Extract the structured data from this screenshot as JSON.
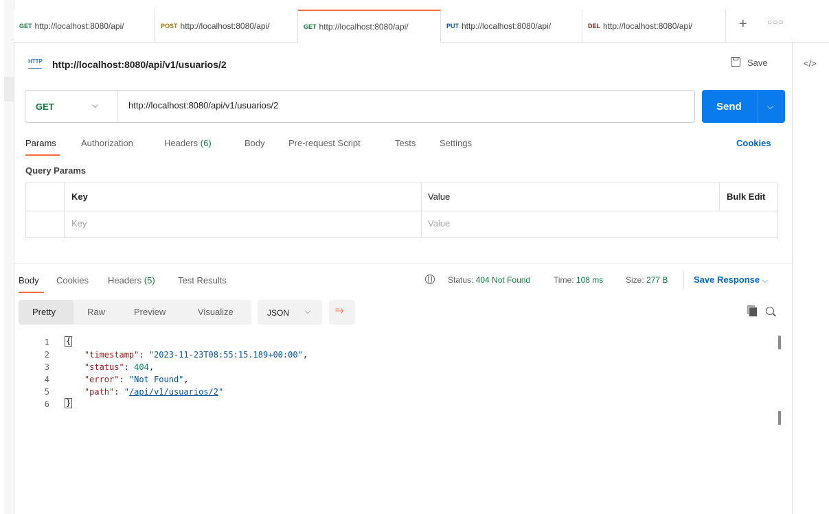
{
  "tabs": [
    {
      "method": "GET",
      "url": "http://localhost:8080/api/"
    },
    {
      "method": "POST",
      "url": "http://localhost:8080/api/"
    },
    {
      "method": "GET",
      "url": "http://localhost:8080/api/"
    },
    {
      "method": "PUT",
      "url": "http://localhost:8080/api/"
    },
    {
      "method": "DEL",
      "url": "http://localhost:8080/api/"
    }
  ],
  "request": {
    "title": "http://localhost:8080/api/v1/usuarios/2",
    "badge": "HTTP",
    "save_label": "Save",
    "method": "GET",
    "url": "http://localhost:8080/api/v1/usuarios/2",
    "send_label": "Send"
  },
  "request_tabs": {
    "params": "Params",
    "authorization": "Authorization",
    "headers": "Headers",
    "headers_count": "(6)",
    "body": "Body",
    "prerequest": "Pre-request Script",
    "tests": "Tests",
    "settings": "Settings",
    "cookies": "Cookies"
  },
  "query_params": {
    "title": "Query Params",
    "col_key": "Key",
    "col_value": "Value",
    "bulk_edit": "Bulk Edit",
    "key_placeholder": "Key",
    "value_placeholder": "Value"
  },
  "response": {
    "tabs": {
      "body": "Body",
      "cookies": "Cookies",
      "headers": "Headers",
      "headers_count": "(5)",
      "test_results": "Test Results"
    },
    "status_label": "Status:",
    "status_value": "404 Not Found",
    "time_label": "Time:",
    "time_value": "108 ms",
    "size_label": "Size:",
    "size_value": "277 B",
    "save_response": "Save Response",
    "formats": [
      "Pretty",
      "Raw",
      "Preview",
      "Visualize"
    ],
    "language": "JSON",
    "code": {
      "line_numbers": [
        "1",
        "2",
        "3",
        "4",
        "5",
        "6"
      ],
      "timestamp_key": "\"timestamp\"",
      "timestamp_value": "\"2023-11-23T08:55:15.189+00:00\"",
      "status_key": "\"status\"",
      "status_value": "404",
      "error_key": "\"error\"",
      "error_value": "\"Not Found\"",
      "path_key": "\"path\"",
      "path_value": "/api/v1/usuarios/2"
    }
  },
  "colors": {
    "accent": "#ff6c37",
    "send": "#097bed",
    "get": "#0f7d3d",
    "post": "#ad7a03",
    "put": "#0053b8",
    "del": "#8e1a10"
  }
}
